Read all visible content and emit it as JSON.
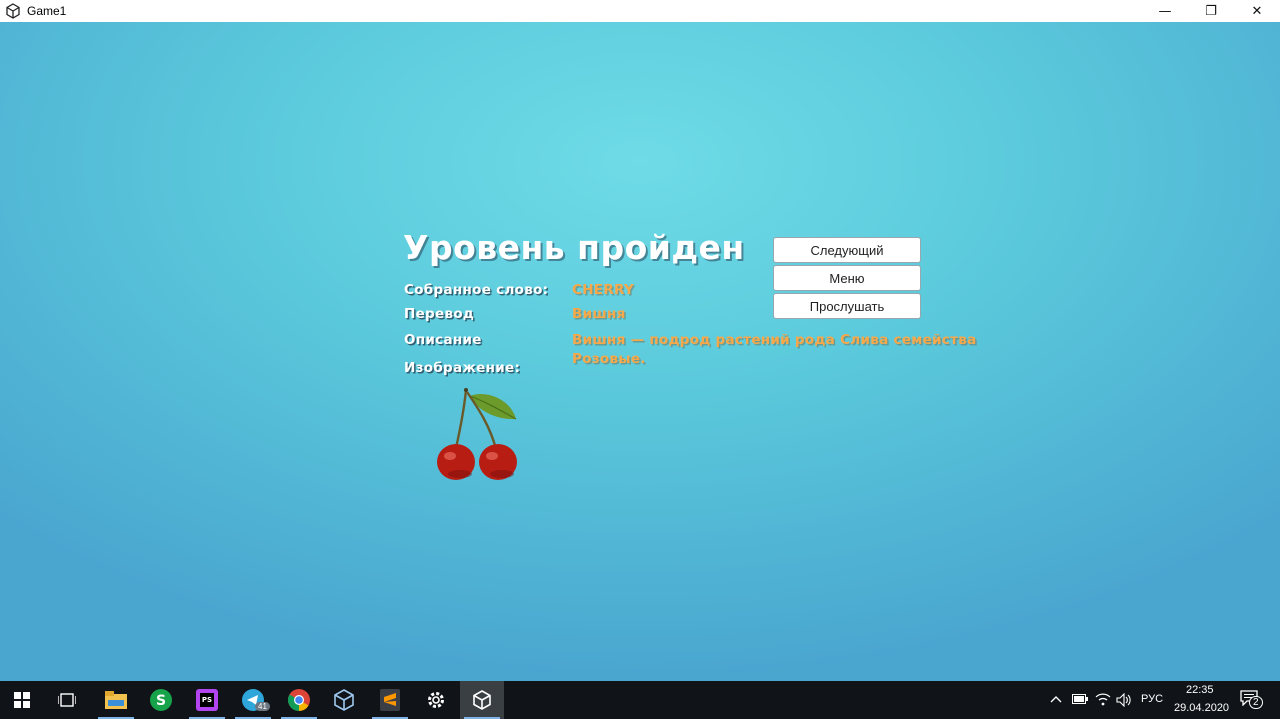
{
  "window": {
    "title": "Game1",
    "controls": {
      "minimize": "—",
      "restore": "❐",
      "close": "✕"
    }
  },
  "level": {
    "heading": "Уровень пройден",
    "word_label": "Собранное слово:",
    "word_value": "CHERRY",
    "translation_label": "Перевод",
    "translation_value": "Вишня",
    "description_label": "Описание",
    "description_value": "Вишня — подрод растений рода Слива семейства Розовые.",
    "image_label": "Изображение:",
    "image_icon": "cherry-image"
  },
  "buttons": {
    "next": "Следующий",
    "menu": "Меню",
    "listen": "Прослушать"
  },
  "taskbar": {
    "apps": [
      "windows-start-icon",
      "task-view-icon",
      "file-explorer-icon",
      "skype-icon",
      "phpstorm-icon",
      "telegram-icon",
      "chrome-icon",
      "virtualbox-icon",
      "sublime-text-icon",
      "settings-icon",
      "unity-icon"
    ],
    "telegram_badge": "41",
    "language": "РУС",
    "time": "22:35",
    "date": "29.04.2020",
    "notifications": "2"
  },
  "colors": {
    "accent_value": "#f6a84a",
    "background": "#5ccbdc",
    "taskbar": "#101418"
  }
}
